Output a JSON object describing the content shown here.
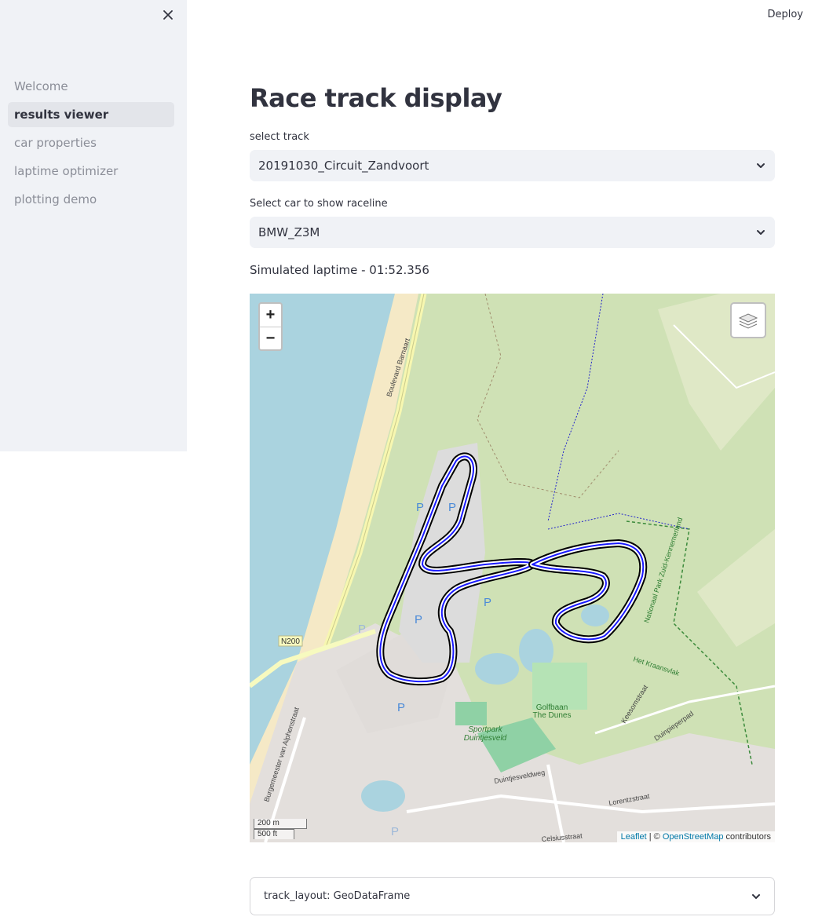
{
  "sidebar": {
    "items": [
      {
        "label": "Welcome"
      },
      {
        "label": "results viewer"
      },
      {
        "label": "car properties"
      },
      {
        "label": "laptime optimizer"
      },
      {
        "label": "plotting demo"
      }
    ],
    "active_index": 1
  },
  "header": {
    "deploy_label": "Deploy"
  },
  "main": {
    "title": "Race track display",
    "track_select": {
      "label": "select track",
      "value": "20191030_Circuit_Zandvoort"
    },
    "car_select": {
      "label": "Select car to show raceline",
      "value": "BMW_Z3M"
    },
    "laptime_text": "Simulated laptime - 01:52.356"
  },
  "map": {
    "zoom_in": "+",
    "zoom_out": "−",
    "scale_metric": "200 m",
    "scale_imperial": "500 ft",
    "attribution_leaflet": "Leaflet",
    "attribution_sep": " | © ",
    "attribution_osm": "OpenStreetMap",
    "attribution_suffix": " contributors",
    "labels": {
      "road_boulevard": "Boulevard Barnaart",
      "road_n200": "N200",
      "golf": "Golfbaan\nThe Dunes",
      "sportpark": "Sportpark\nDuintjesveld",
      "road_duintjesveldweg": "Duintjesveldweg",
      "road_kraansvlak": "Het Kraansvlak",
      "park": "Nationaal Park Zuid-Kennemerland",
      "road_keesomstraat": "Keesomstraat",
      "road_duinpieperpad": "Duinpieperpad",
      "road_lorentzstraat": "Lorentzstraat",
      "road_celsiusstraat": "Celsiusstraat",
      "road_alphenstraat": "Burgemeester van Alphenstraat",
      "parking": "P"
    },
    "colors": {
      "racing_line": "#1a1aff",
      "track_outline": "#000000",
      "sea": "#aad3df",
      "dunes": "#cfe1b5",
      "sand": "#f5e9c6"
    }
  },
  "expander": {
    "label": "track_layout: GeoDataFrame"
  }
}
